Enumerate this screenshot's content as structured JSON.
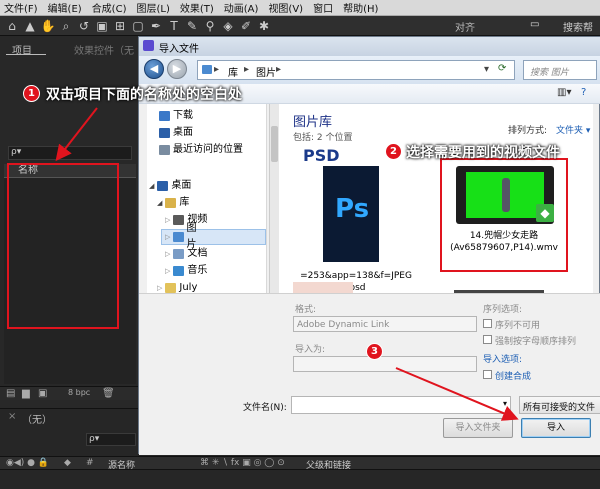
{
  "menu": [
    "文件(F)",
    "编辑(E)",
    "合成(C)",
    "图层(L)",
    "效果(T)",
    "动画(A)",
    "视图(V)",
    "窗口",
    "帮助(H)"
  ],
  "toolbar": {
    "snap_label": "对齐",
    "search_help": "搜索帮"
  },
  "project_panel": {
    "tab_project": "项目",
    "tab_effects": "效果控件（无",
    "search_placeholder": "ρ▾",
    "column_name": "名称",
    "bpc": "8 bpc"
  },
  "timeline": {
    "tab_none": "（无）",
    "source_name": "源名称",
    "parent": "父级和链接",
    "search": "ρ▾"
  },
  "dialog": {
    "title": "导入文件",
    "breadcrumb": [
      "库",
      "图片"
    ],
    "search_placeholder": "搜索 图片",
    "nav_items": [
      {
        "label": "下载",
        "color": "#3a78c8"
      },
      {
        "label": "桌面",
        "color": "#2b5fa8"
      },
      {
        "label": "最近访问的位置",
        "color": "#7a8ca0"
      },
      {
        "label": "桌面",
        "color": "#2b5fa8"
      },
      {
        "label": "库",
        "color": "#d9b24a"
      },
      {
        "label": "视频",
        "color": "#5a5a5a"
      },
      {
        "label": "图片",
        "color": "#4b8ad0"
      },
      {
        "label": "文档",
        "color": "#7a9cc6"
      },
      {
        "label": "音乐",
        "color": "#3a8ad0"
      },
      {
        "label": "July",
        "color": "#e2c25a"
      }
    ],
    "library_title": "图片库",
    "library_subtitle": "包括: 2 个位置",
    "sort_label": "排列方式:",
    "sort_value": "文件夹 ▾",
    "files": [
      {
        "name": "=253&app=138&f=JPEG .psd",
        "thumb_text": "Ps",
        "thumb_header": "PSD"
      },
      {
        "name": "14.兜帽少女走路 (Av65879607,P14).wmv"
      }
    ],
    "format_label": "格式:",
    "format_value": "Adobe Dynamic Link",
    "import_as_label": "导入为:",
    "sequence_options": "序列选项:",
    "seq_unavailable": "序列不可用",
    "force_alpha": "强制按字母顺序排列",
    "import_options": "导入选项:",
    "create_comp": "创建合成",
    "filename_label": "文件名(N):",
    "filetype_value": "所有可接受的文件",
    "import_folder_btn": "导入文件夹",
    "import_btn": "导入"
  },
  "annotations": [
    {
      "num": "1",
      "text": "双击项目下面的名称处的空白处"
    },
    {
      "num": "2",
      "text": "选择需要用到的视频文件"
    },
    {
      "num": "3",
      "text": ""
    }
  ],
  "colors": {
    "annotation_red": "#e0141e",
    "ae_bg": "#232323",
    "dialog_bg": "#f0f0f0"
  }
}
